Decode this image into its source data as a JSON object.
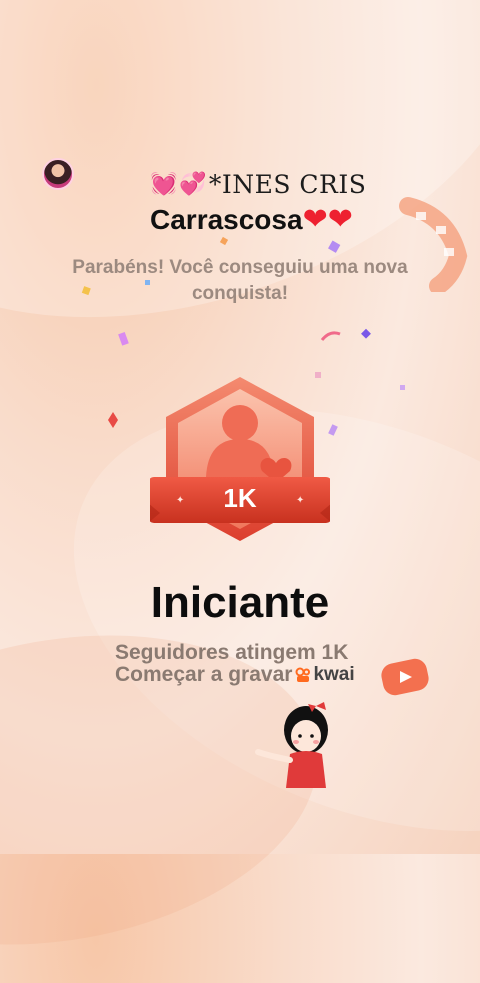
{
  "user": {
    "name_line1": "*INES CRIS",
    "name_line2": "Carrascosa",
    "decor_left": [
      "pink-heart-sparkle",
      "pink-heart-ribbon"
    ],
    "decor_right": [
      "red-heart",
      "red-heart"
    ]
  },
  "message": "Parabéns! Você conseguiu uma nova conquista!",
  "badge": {
    "label": "1K",
    "icon": "person-heart-badge-icon"
  },
  "achievement": {
    "title": "Iniciante",
    "description": "Seguidores atingem 1K",
    "cta": "Começar a gravar",
    "brand": "kwai"
  },
  "colors": {
    "badge_primary": "#e8543f",
    "badge_light": "#f7a88f",
    "title": "#0d0d0d",
    "subtitle": "#8a7a71",
    "brand": "#ff6a1f"
  }
}
